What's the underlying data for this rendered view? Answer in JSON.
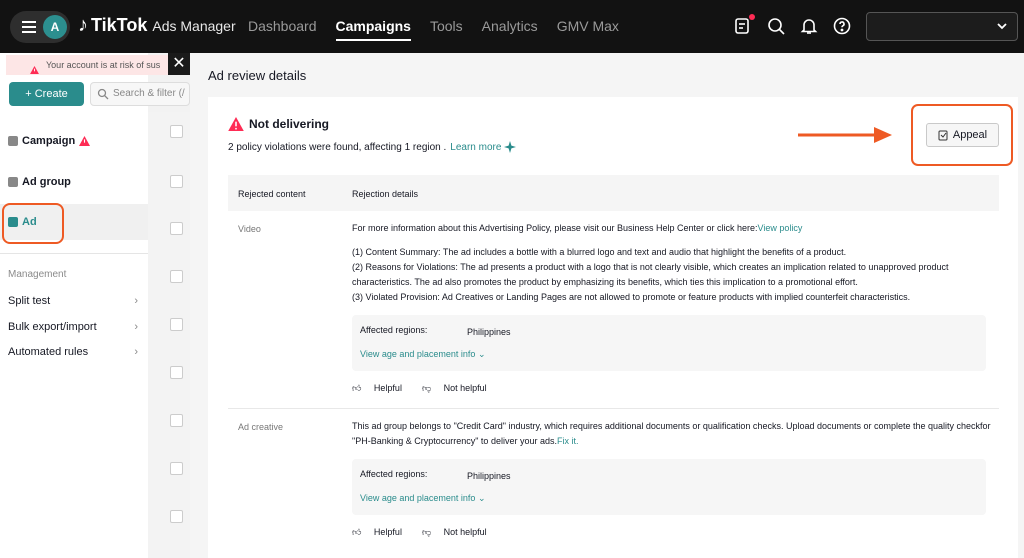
{
  "header": {
    "avatar_initial": "A",
    "logo_brand": "TikTok",
    "logo_product": "Ads Manager",
    "nav": [
      {
        "label": "Dashboard",
        "active": false
      },
      {
        "label": "Campaigns",
        "active": true
      },
      {
        "label": "Tools",
        "active": false
      },
      {
        "label": "Analytics",
        "active": false
      },
      {
        "label": "GMV Max",
        "active": false
      }
    ],
    "icons": [
      "requests-icon",
      "search-icon",
      "bell-icon",
      "help-icon"
    ],
    "account_select_value": ""
  },
  "sidebar": {
    "warning_text": "Your account is at risk of sus",
    "create_label": "+ Create",
    "search_placeholder": "Search & filter (/",
    "levels": [
      {
        "label": "Campaign",
        "has_warning": true
      },
      {
        "label": "Ad group",
        "has_warning": false
      },
      {
        "label": "Ad",
        "selected": true
      }
    ],
    "management_title": "Management",
    "management_items": [
      {
        "label": "Split test"
      },
      {
        "label": "Bulk export/import"
      },
      {
        "label": "Automated rules"
      }
    ]
  },
  "panel": {
    "title": "Ad review details",
    "status": "Not delivering",
    "violations_text": "2 policy violations were found, affecting 1 region .",
    "learn_more": "Learn more",
    "appeal_label": "Appeal",
    "columns": [
      "Rejected content",
      "Rejection details"
    ],
    "rows": [
      {
        "content": "Video",
        "intro": "For more information about this Advertising Policy, please visit our Business Help Center or click here:",
        "intro_link": "View policy",
        "details": [
          "(1) Content Summary: The ad includes a bottle with a blurred logo and text and audio that highlight the benefits of a product.",
          "(2) Reasons for Violations: The ad presents a product with a logo that is not clearly visible, which creates an implication related to unapproved product characteristics. The ad also promotes the product by emphasizing its benefits, which ties this implication to a promotional effort.",
          "(3) Violated Provision: Ad Creatives or Landing Pages are not allowed to promote or feature products with implied counterfeit characteristics."
        ],
        "regions_label": "Affected regions:",
        "regions_value": "Philippines",
        "placement_link": "View age and placement info",
        "helpful": "Helpful",
        "not_helpful": "Not helpful"
      },
      {
        "content": "Ad creative",
        "intro": "This ad group belongs to \"Credit Card\" industry, which requires additional documents or qualification checks. Upload documents or complete the quality checkfor \"PH-Banking & Cryptocurrency\" to deliver your ads.",
        "intro_link": "Fix it.",
        "regions_label": "Affected regions:",
        "regions_value": "Philippines",
        "placement_link": "View age and placement info",
        "helpful": "Helpful",
        "not_helpful": "Not helpful"
      }
    ]
  },
  "colors": {
    "accent": "#2a8c8c",
    "highlight_ring": "#ee5a24",
    "topbar": "#121212",
    "warning": "#fe2c55"
  }
}
